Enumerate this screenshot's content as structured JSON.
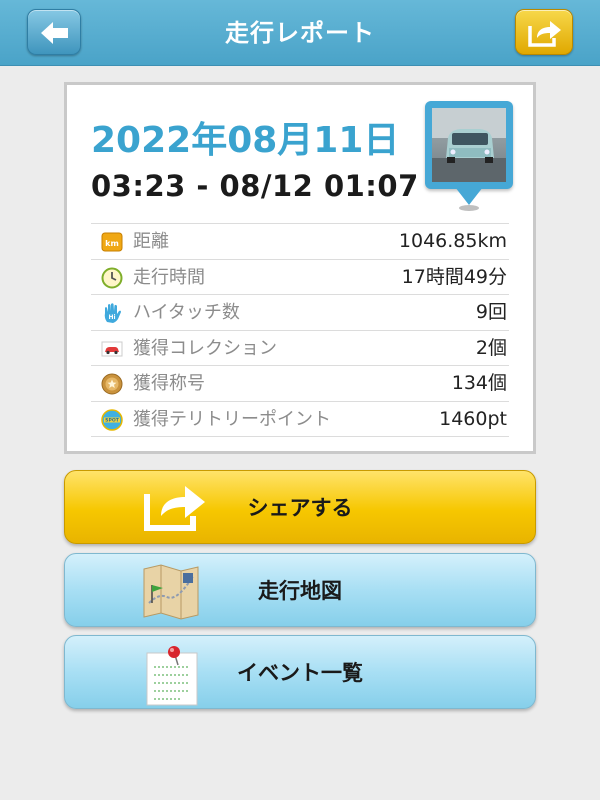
{
  "header": {
    "title": "走行レポート"
  },
  "report": {
    "date": "2022年08月11日",
    "time_range": "03:23 - 08/12 01:07",
    "stats": [
      {
        "icon": "km-badge-icon",
        "label": "距離",
        "value": "1046.85km"
      },
      {
        "icon": "clock-icon",
        "label": "走行時間",
        "value": "17時間49分"
      },
      {
        "icon": "hand-icon",
        "label": "ハイタッチ数",
        "value": "9回"
      },
      {
        "icon": "car-card-icon",
        "label": "獲得コレクション",
        "value": "2個"
      },
      {
        "icon": "medal-icon",
        "label": "獲得称号",
        "value": "134個"
      },
      {
        "icon": "spot-badge-icon",
        "label": "獲得テリトリーポイント",
        "value": "1460pt"
      }
    ]
  },
  "buttons": {
    "share_label": "シェアする",
    "map_label": "走行地図",
    "events_label": "イベント一覧"
  },
  "colors": {
    "header": "#4aa3c8",
    "date_accent": "#3aa3cf",
    "share_button": "#f6c700",
    "secondary_button": "#a8dff4"
  }
}
